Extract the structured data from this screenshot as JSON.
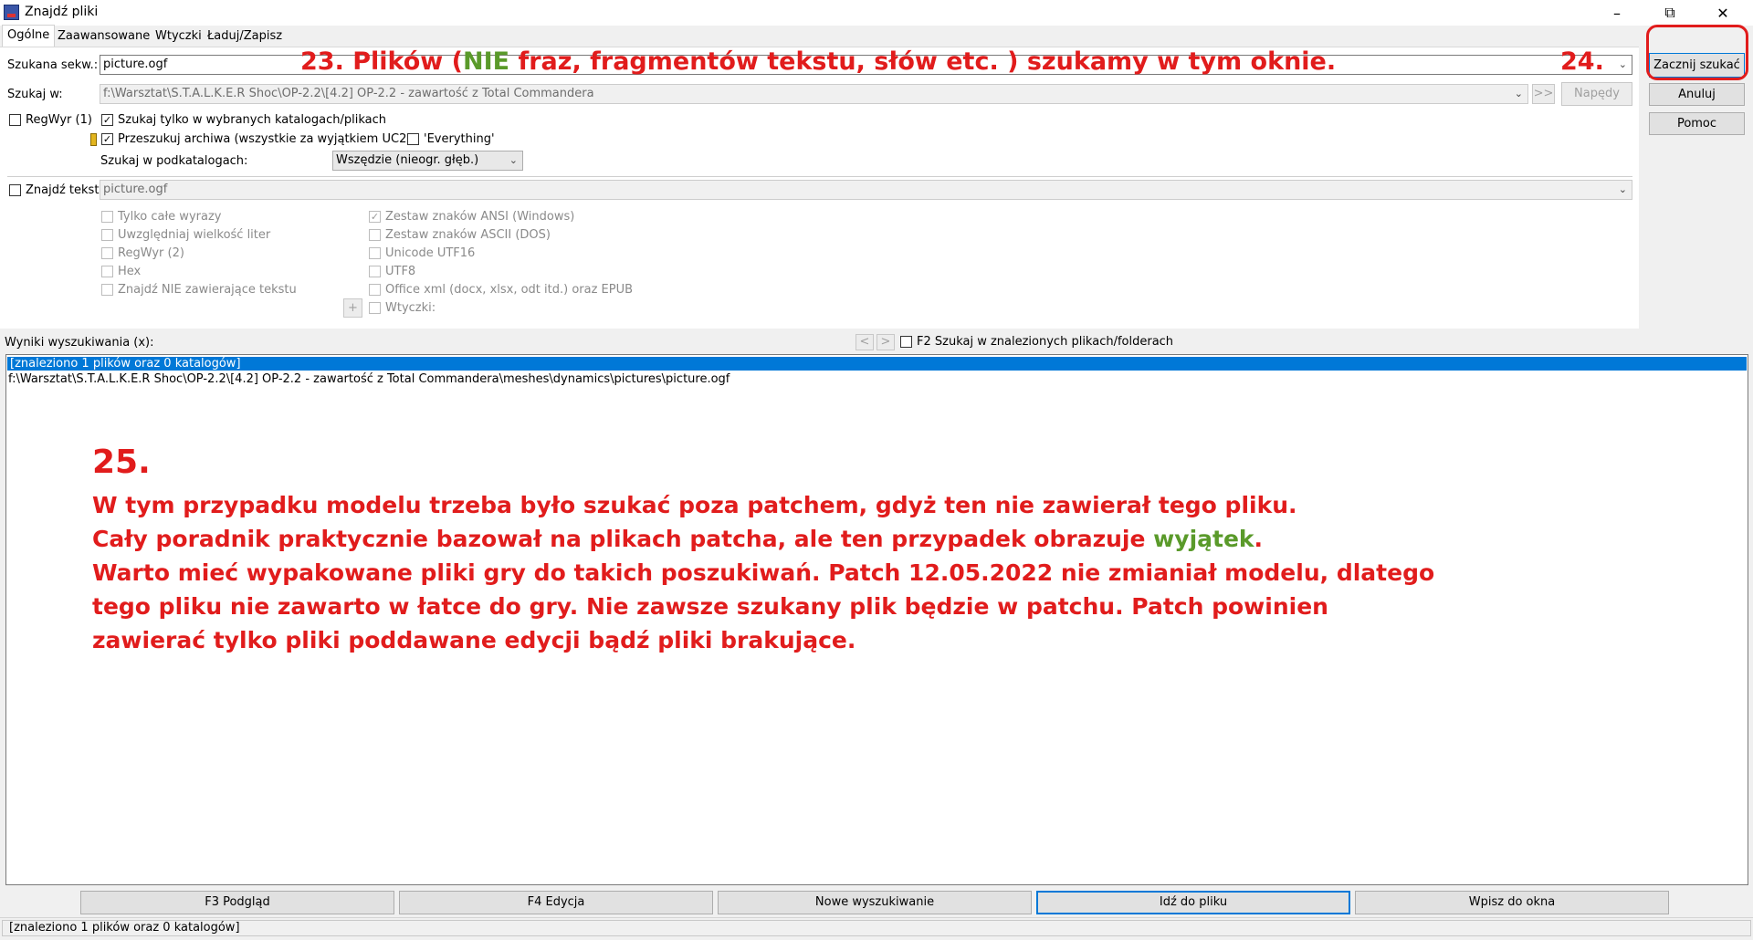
{
  "window": {
    "title": "Znajdź pliki"
  },
  "tabs": [
    "Ogólne",
    "Zaawansowane",
    "Wtyczki",
    "Ładuj/Zapisz"
  ],
  "search": {
    "name_label": "Szukana sekw.:",
    "name_value": "picture.ogf",
    "in_label": "Szukaj w:",
    "in_value": "f:\\Warsztat\\S.T.A.L.K.E.R Shoc\\OP-2.2\\[4.2] OP-2.2 - zawartość z Total Commandera",
    "arrows_label": ">>",
    "drives_label": "Napędy"
  },
  "options": {
    "regex1": "RegWyr (1)",
    "only_selected": "Szukaj tylko w wybranych katalogach/plikach",
    "archives": "Przeszukuj archiwa (wszystkie za wyjątkiem UC2)",
    "everything": "'Everything'",
    "subdirs_label": "Szukaj w podkatalogach:",
    "subdirs_value": "Wszędzie (nieogr. głęb.)"
  },
  "text_search": {
    "label": "Znajdź tekst:",
    "value": "picture.ogf",
    "left_options": [
      "Tylko całe wyrazy",
      "Uwzględniaj wielkość liter",
      "RegWyr (2)",
      "Hex",
      "Znajdź NIE zawierające tekstu"
    ],
    "right_options": [
      "Zestaw znaków ANSI (Windows)",
      "Zestaw znaków ASCII (DOS)",
      "Unicode UTF16",
      "UTF8",
      "Office xml (docx, xlsx, odt itd.) oraz EPUB",
      "Wtyczki:"
    ],
    "plus_label": "+"
  },
  "side_buttons": {
    "start": "Zacznij szukać",
    "cancel": "Anuluj",
    "help": "Pomoc"
  },
  "results": {
    "label": "Wyniki wyszukiwania (x):",
    "nav_prev": "<",
    "nav_next": ">",
    "f2_label": "F2 Szukaj w znalezionych plikach/folderach",
    "summary": "[znaleziono 1 plików oraz 0 katalogów]",
    "path": "f:\\Warsztat\\S.T.A.L.K.E.R Shoc\\OP-2.2\\[4.2] OP-2.2 - zawartość z Total Commandera\\meshes\\dynamics\\pictures\\picture.ogf"
  },
  "bottom_buttons": [
    "F3 Podgląd",
    "F4 Edycja",
    "Nowe wyszukiwanie",
    "Idź do pliku",
    "Wpisz do okna"
  ],
  "status": "[znaleziono 1 plików oraz 0 katalogów]",
  "annotations": {
    "a23_pre": "23. Plików (",
    "a23_nie": "NIE",
    "a23_post": " fraz, fragmentów tekstu, słów etc. ) szukamy w tym oknie.",
    "a24": "24.",
    "a25_num": "25.",
    "a25_l1": "W tym przypadku modelu trzeba było szukać poza patchem, gdyż ten nie zawierał tego pliku.",
    "a25_l2_pre": "Cały poradnik praktycznie bazował na plikach patcha, ale ten przypadek obrazuje ",
    "a25_l2_green": "wyjątek",
    "a25_l2_post": ".",
    "a25_l3": "Warto mieć wypakowane pliki gry do takich poszukiwań. Patch 12.05.2022 nie zmianiał modelu, dlatego",
    "a25_l4": "tego pliku nie zawarto w łatce do gry. Nie zawsze szukany plik będzie w patchu. Patch powinien",
    "a25_l5": "zawierać tylko pliki poddawane edycji bądź pliki brakujące."
  },
  "colors": {
    "annotation_red": "#e11c1c",
    "annotation_green": "#5a9a2a",
    "selection_blue": "#0078d7"
  }
}
